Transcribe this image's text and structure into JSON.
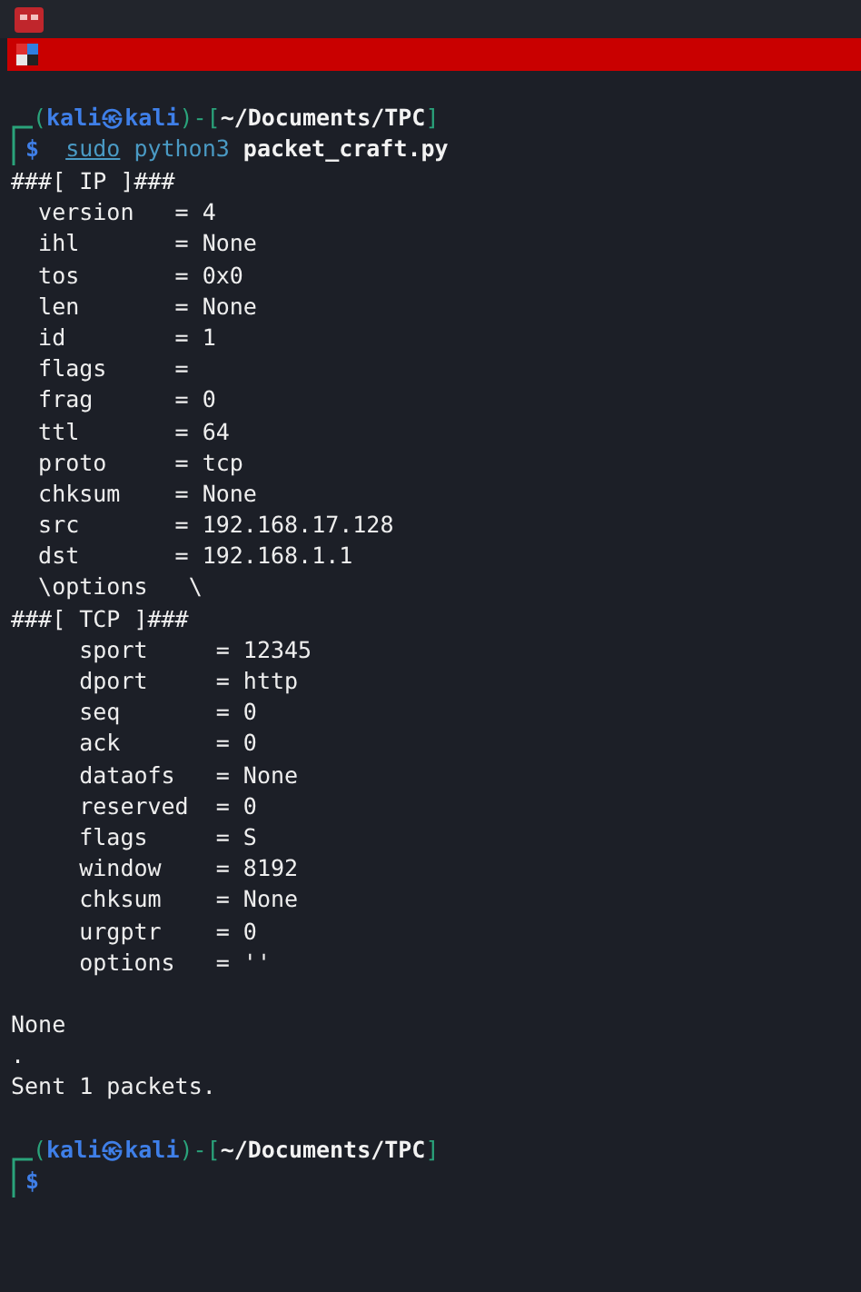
{
  "prompts": [
    {
      "segments": [
        {
          "kind": "frame",
          "text": "("
        },
        {
          "kind": "user",
          "text": "kali㉿kali"
        },
        {
          "kind": "frame",
          "text": ")-["
        },
        {
          "kind": "path",
          "text": "~/Documents/TPC"
        },
        {
          "kind": "frame",
          "text": "]"
        }
      ],
      "command": {
        "sudo": "sudo",
        "program": "python3",
        "args": "packet_craft.py"
      }
    },
    {
      "segments": [
        {
          "kind": "frame",
          "text": "("
        },
        {
          "kind": "user",
          "text": "kali㉿kali"
        },
        {
          "kind": "frame",
          "text": ")-["
        },
        {
          "kind": "path",
          "text": "~/Documents/TPC"
        },
        {
          "kind": "frame",
          "text": "]"
        }
      ]
    }
  ],
  "output": [
    {
      "kind": "text",
      "text": "###[ IP ]###"
    },
    {
      "kind": "text",
      "text": "  version   = 4"
    },
    {
      "kind": "text",
      "text": "  ihl       = None"
    },
    {
      "kind": "text",
      "text": "  tos       = 0x0"
    },
    {
      "kind": "text",
      "text": "  len       = None"
    },
    {
      "kind": "text",
      "text": "  id        = 1"
    },
    {
      "kind": "text",
      "text": "  flags     ="
    },
    {
      "kind": "text",
      "text": "  frag      = 0"
    },
    {
      "kind": "text",
      "text": "  ttl       = 64"
    },
    {
      "kind": "text",
      "text": "  proto     = tcp"
    },
    {
      "kind": "text",
      "text": "  chksum    = None"
    },
    {
      "kind": "text",
      "text": "  src       = 192.168.17.128"
    },
    {
      "kind": "text",
      "text": "  dst       = 192.168.1.1"
    },
    {
      "kind": "text",
      "text": "  \\options   \\"
    },
    {
      "kind": "text",
      "text": "###[ TCP ]###"
    },
    {
      "kind": "text",
      "text": "     sport     = 12345"
    },
    {
      "kind": "text",
      "text": "     dport     = http"
    },
    {
      "kind": "text",
      "text": "     seq       = 0"
    },
    {
      "kind": "text",
      "text": "     ack       = 0"
    },
    {
      "kind": "text",
      "text": "     dataofs   = None"
    },
    {
      "kind": "text",
      "text": "     reserved  = 0"
    },
    {
      "kind": "text",
      "text": "     flags     = S"
    },
    {
      "kind": "text",
      "text": "     window    = 8192"
    },
    {
      "kind": "text",
      "text": "     chksum    = None"
    },
    {
      "kind": "text",
      "text": "     urgptr    = 0"
    },
    {
      "kind": "text",
      "text": "     options   = ''"
    },
    {
      "kind": "blank"
    },
    {
      "kind": "text",
      "text": "None"
    },
    {
      "kind": "text",
      "text": "."
    },
    {
      "kind": "text",
      "text": "Sent 1 packets."
    },
    {
      "kind": "blank"
    }
  ],
  "final_prompt": {
    "symbol": "$"
  },
  "first_prompt_symbol": "$"
}
